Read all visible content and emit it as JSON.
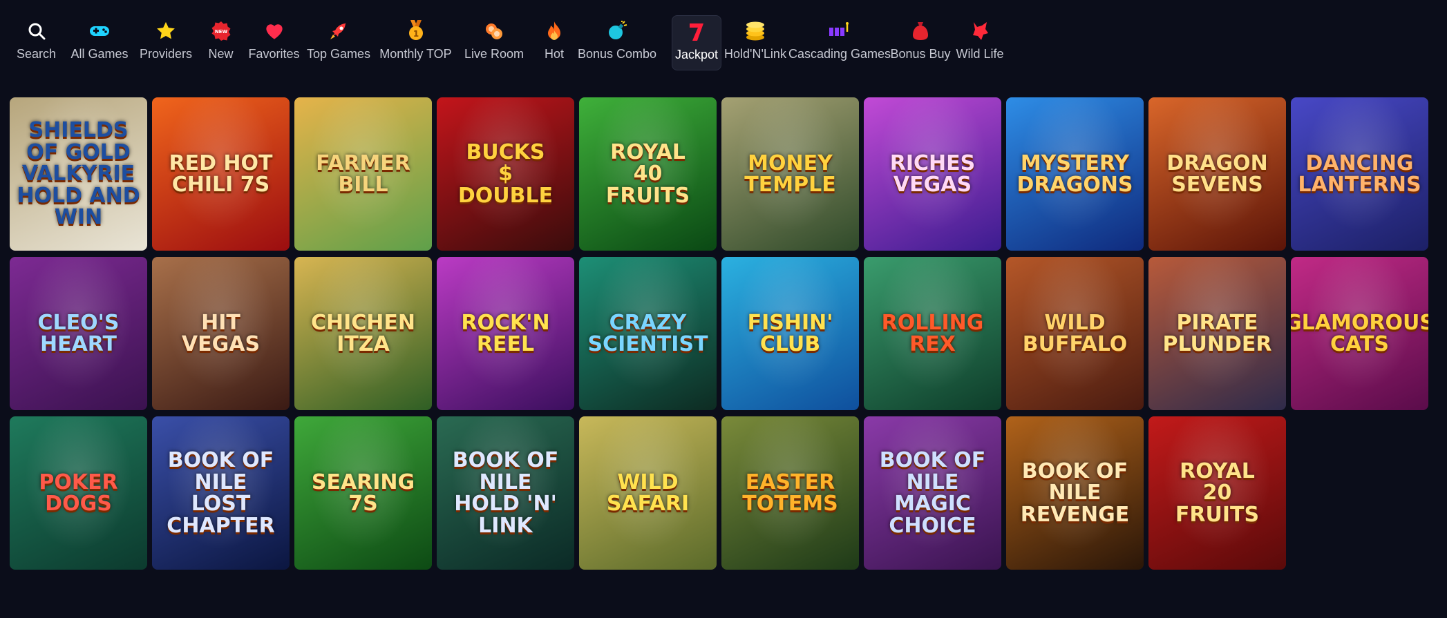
{
  "nav": [
    {
      "id": "search",
      "label": "Search",
      "icon": "search-icon"
    },
    {
      "id": "all-games",
      "label": "All Games",
      "icon": "gamepad-icon"
    },
    {
      "id": "providers",
      "label": "Providers",
      "icon": "star-icon"
    },
    {
      "id": "new",
      "label": "New",
      "icon": "new-badge-icon",
      "badge": "NEW"
    },
    {
      "id": "favorites",
      "label": "Favorites",
      "icon": "heart-icon"
    },
    {
      "id": "top-games",
      "label": "Top Games",
      "icon": "rocket-icon"
    },
    {
      "id": "monthly-top",
      "label": "Monthly TOP",
      "icon": "medal-icon"
    },
    {
      "id": "live-room",
      "label": "Live Room",
      "icon": "chips-icon"
    },
    {
      "id": "hot",
      "label": "Hot",
      "icon": "flame-icon"
    },
    {
      "id": "bonus-combo",
      "label": "Bonus Combo",
      "icon": "bomb-icon"
    },
    {
      "id": "jackpot",
      "label": "Jackpot",
      "icon": "seven-icon",
      "active": true,
      "glyph": "7"
    },
    {
      "id": "hold-n-link",
      "label": "Hold'N'Link",
      "icon": "coin-stack-icon"
    },
    {
      "id": "cascading-games",
      "label": "Cascading Games",
      "icon": "cascade-icon"
    },
    {
      "id": "bonus-buy",
      "label": "Bonus Buy",
      "icon": "money-bag-icon"
    },
    {
      "id": "wild-life",
      "label": "Wild Life",
      "icon": "wolf-icon"
    }
  ],
  "games": [
    {
      "title": "Shields of Gold Valkyrie\nHold and Win",
      "bg": [
        "#e9e4d6",
        "#b7a67c"
      ],
      "color": "#1d4ea0"
    },
    {
      "title": "Red Hot\nChili 7s",
      "bg": [
        "#9b0d10",
        "#f0651c"
      ],
      "color": "#ffe7a6"
    },
    {
      "title": "Farmer\nBill",
      "bg": [
        "#5ea04a",
        "#e6b34a"
      ],
      "color": "#f6d47c"
    },
    {
      "title": "Bucks\n$\nDouble",
      "bg": [
        "#3a0c0c",
        "#c3151b"
      ],
      "color": "#ffd23f"
    },
    {
      "title": "Royal\n40\nFruits",
      "bg": [
        "#0a4814",
        "#3fb03a"
      ],
      "color": "#ffe38a"
    },
    {
      "title": "Money\nTemple",
      "bg": [
        "#2f4a2a",
        "#a5a173"
      ],
      "color": "#ffd23f"
    },
    {
      "title": "Riches\nVegas",
      "bg": [
        "#3b1c8f",
        "#c24ad6"
      ],
      "color": "#ffd9f6"
    },
    {
      "title": "Mystery\nDragons",
      "bg": [
        "#0f2a7d",
        "#2e8de6"
      ],
      "color": "#ffd46b"
    },
    {
      "title": "Dragon\nSevens",
      "bg": [
        "#5b1408",
        "#d9662a"
      ],
      "color": "#ffe08a"
    },
    {
      "title": "Dancing\nLanterns",
      "bg": [
        "#1c2066",
        "#4848c6"
      ],
      "color": "#ffb36b"
    },
    {
      "title": "Cleo's\nHeart",
      "bg": [
        "#3a124f",
        "#7d2a93"
      ],
      "color": "#9fd8ff"
    },
    {
      "title": "Hit Vegas",
      "bg": [
        "#3a1a14",
        "#a8704a"
      ],
      "color": "#ffe1b5"
    },
    {
      "title": "Chichen\nItza",
      "bg": [
        "#2e5e24",
        "#d8b552"
      ],
      "color": "#ffe48a"
    },
    {
      "title": "Rock'n\nReel",
      "bg": [
        "#3b0f5e",
        "#bb3bc4"
      ],
      "color": "#ffe24f"
    },
    {
      "title": "Crazy\nScientist",
      "bg": [
        "#0d2b22",
        "#1d8f76"
      ],
      "color": "#7ad6ff"
    },
    {
      "title": "Fishin'\nClub",
      "bg": [
        "#0f4f9d",
        "#2bb1e0"
      ],
      "color": "#ffe24f"
    },
    {
      "title": "Rolling\nRex",
      "bg": [
        "#0e3d2a",
        "#3a9c6d"
      ],
      "color": "#ff5a2a"
    },
    {
      "title": "Wild\nBuffalo",
      "bg": [
        "#4a1b10",
        "#b55728"
      ],
      "color": "#ffd46b"
    },
    {
      "title": "Pirate\nPlunder",
      "bg": [
        "#2e2a4a",
        "#b85a3a"
      ],
      "color": "#ffe48a"
    },
    {
      "title": "Glamorous\nCats",
      "bg": [
        "#5a0c4a",
        "#c12a86"
      ],
      "color": "#ffd23f"
    },
    {
      "title": "Poker\nDogs",
      "bg": [
        "#0c3a2e",
        "#1f7a5c"
      ],
      "color": "#ff5a4a"
    },
    {
      "title": "Book of Nile\nLost Chapter",
      "bg": [
        "#0b1640",
        "#3a4fa8"
      ],
      "color": "#dfe8ff"
    },
    {
      "title": "Searing 7s",
      "bg": [
        "#0d4a14",
        "#3fa83a"
      ],
      "color": "#ffe48a"
    },
    {
      "title": "Book of Nile\nHold 'N' Link",
      "bg": [
        "#0b2a26",
        "#2a6a52"
      ],
      "color": "#dfe8ff"
    },
    {
      "title": "Wild\nSafari",
      "bg": [
        "#5a6a2a",
        "#c8b85a"
      ],
      "color": "#ffe24f"
    },
    {
      "title": "Easter\nTotems",
      "bg": [
        "#1e3a18",
        "#7a8a3a"
      ],
      "color": "#ffb32a"
    },
    {
      "title": "Book of Nile\nMagic Choice",
      "bg": [
        "#3a1450",
        "#8a3aa8"
      ],
      "color": "#cfe0ff"
    },
    {
      "title": "Book of Nile\nRevenge",
      "bg": [
        "#2a1608",
        "#b0621a"
      ],
      "color": "#ffe9b5"
    },
    {
      "title": "Royal\n20\nFruits",
      "bg": [
        "#5a0a0a",
        "#c21a1a"
      ],
      "color": "#ffe38a"
    }
  ]
}
